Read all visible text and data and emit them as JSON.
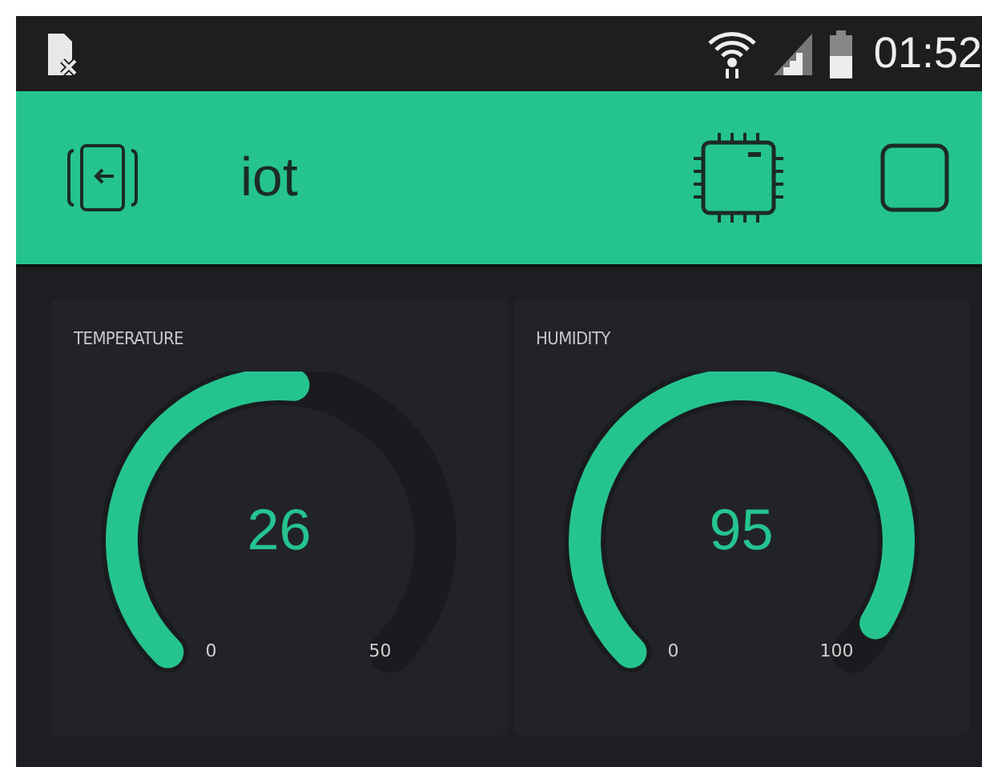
{
  "status_bar": {
    "time": "01:52"
  },
  "header": {
    "title": "iot"
  },
  "gauges": [
    {
      "label": "TEMPERATURE",
      "value": "26",
      "min": "0",
      "max": "50",
      "level": 0.52
    },
    {
      "label": "HUMIDITY",
      "value": "95",
      "min": "0",
      "max": "100",
      "level": 0.95
    }
  ]
}
